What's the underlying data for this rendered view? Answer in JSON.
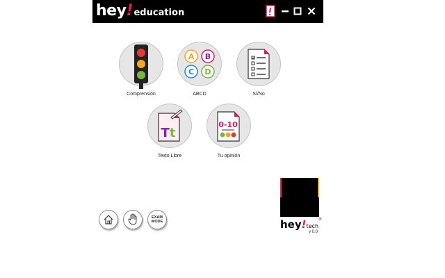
{
  "titlebar": {
    "brand_main": "hey",
    "brand_excl": "!",
    "brand_sub": "education"
  },
  "menu": [
    {
      "label": "Comprensión",
      "icon": "traffic-light-icon"
    },
    {
      "label": "ABCD",
      "icon": "abcd-icon",
      "letters": [
        "A",
        "B",
        "C",
        "D"
      ]
    },
    {
      "label": "Sí/No",
      "icon": "checklist-icon"
    },
    {
      "label": "Texto Libre",
      "icon": "free-text-icon",
      "glyph": "Tt"
    },
    {
      "label": "Tu opinión",
      "icon": "opinion-icon",
      "glyph": "0-10"
    }
  ],
  "bottom": {
    "exam_line1": "EXAM",
    "exam_line2": "MODE"
  },
  "footer": {
    "brand_main": "hey",
    "brand_excl": "!",
    "brand_sub": "tech",
    "reg": "®",
    "version": "v 0.0"
  },
  "colors": {
    "accent": "#e8175d",
    "titlebar": "#000000",
    "circle": "#e6e6e6"
  }
}
